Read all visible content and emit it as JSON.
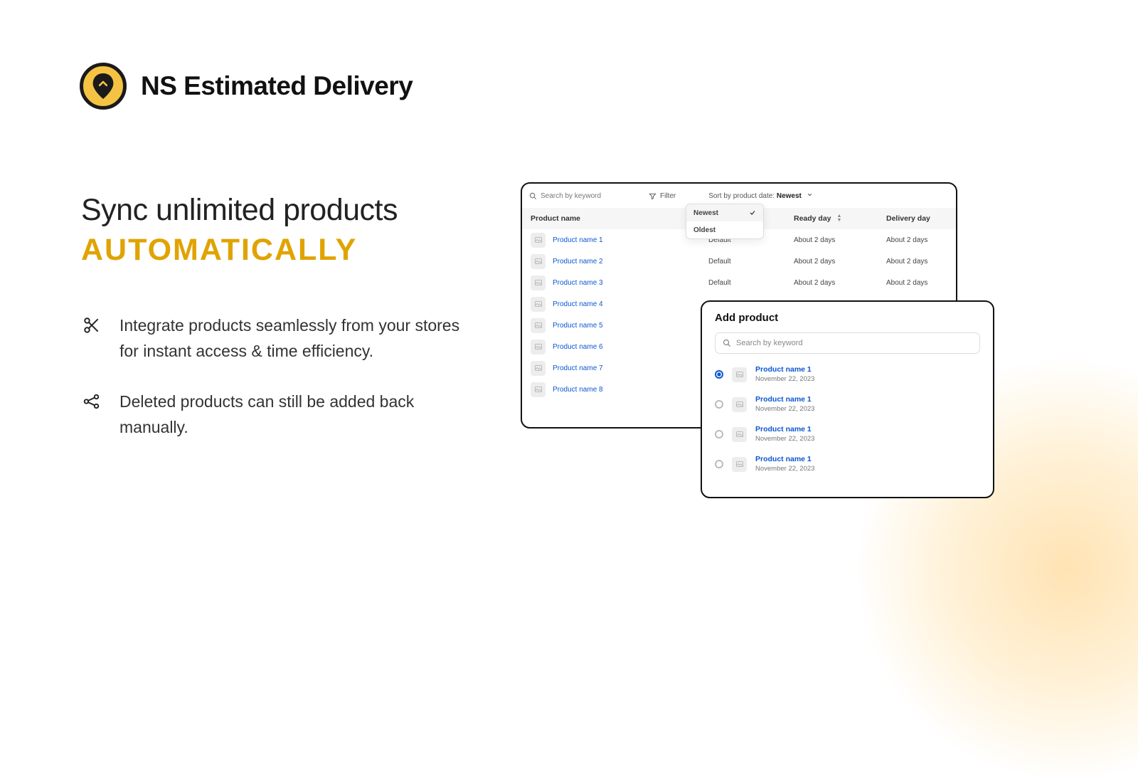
{
  "brand": {
    "name": "NS Estimated Delivery"
  },
  "headline": {
    "line1": "Sync unlimited products",
    "accent": "AUTOMATICALLY"
  },
  "bullets": {
    "0": "Integrate products seamlessly from your stores for instant access & time efficiency.",
    "1": "Deleted products can still be added back manually."
  },
  "toolbar": {
    "search_placeholder": "Search by keyword",
    "filter_label": "Filter",
    "sort_prefix": "Sort by product date: ",
    "sort_value": "Newest"
  },
  "dropdown": {
    "0": "Newest",
    "1": "Oldest"
  },
  "columns": {
    "name": "Product name",
    "ready": "Ready day",
    "delivery": "Delivery day"
  },
  "cell_default": "Default",
  "cell_about": "About 2 days",
  "products": {
    "0": "Product name 1",
    "1": "Product name 2",
    "2": "Product name 3",
    "3": "Product name 4",
    "4": "Product name 5",
    "5": "Product name 6",
    "6": "Product name 7",
    "7": "Product name 8"
  },
  "modal": {
    "title": "Add product",
    "search_placeholder": "Search by keyword",
    "item_name": "Product name 1",
    "item_date": "November 22, 2023"
  }
}
